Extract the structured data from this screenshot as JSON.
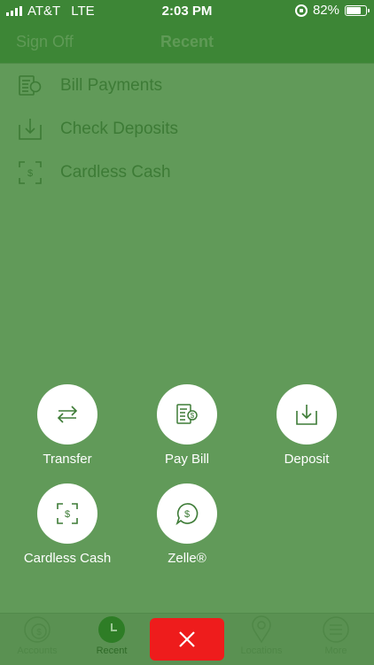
{
  "status_bar": {
    "carrier": "AT&T",
    "network": "LTE",
    "time": "2:03 PM",
    "battery": "82%",
    "battery_level": 0.82
  },
  "nav": {
    "sign_off": "Sign Off",
    "title": "Recent"
  },
  "menu": [
    {
      "label": "Bill Payments",
      "icon": "bill-icon"
    },
    {
      "label": "Check Deposits",
      "icon": "deposit-icon"
    },
    {
      "label": "Cardless Cash",
      "icon": "cardless-cash-icon"
    }
  ],
  "actions": [
    {
      "label": "Transfer",
      "icon": "transfer-icon"
    },
    {
      "label": "Pay Bill",
      "icon": "pay-bill-icon"
    },
    {
      "label": "Deposit",
      "icon": "deposit-icon"
    },
    {
      "label": "Cardless Cash",
      "icon": "cardless-cash-icon"
    },
    {
      "label": "Zelle®",
      "icon": "zelle-icon"
    }
  ],
  "tabs": [
    {
      "label": "Accounts",
      "icon": "accounts-icon"
    },
    {
      "label": "Recent",
      "icon": "clock-icon"
    },
    {
      "label": "",
      "icon": "close-icon"
    },
    {
      "label": "Locations",
      "icon": "location-pin-icon"
    },
    {
      "label": "More",
      "icon": "menu-icon"
    }
  ],
  "colors": {
    "brand_green": "#3d8636",
    "overlay_green": "#619a59",
    "close_red": "#ee1c1c"
  }
}
